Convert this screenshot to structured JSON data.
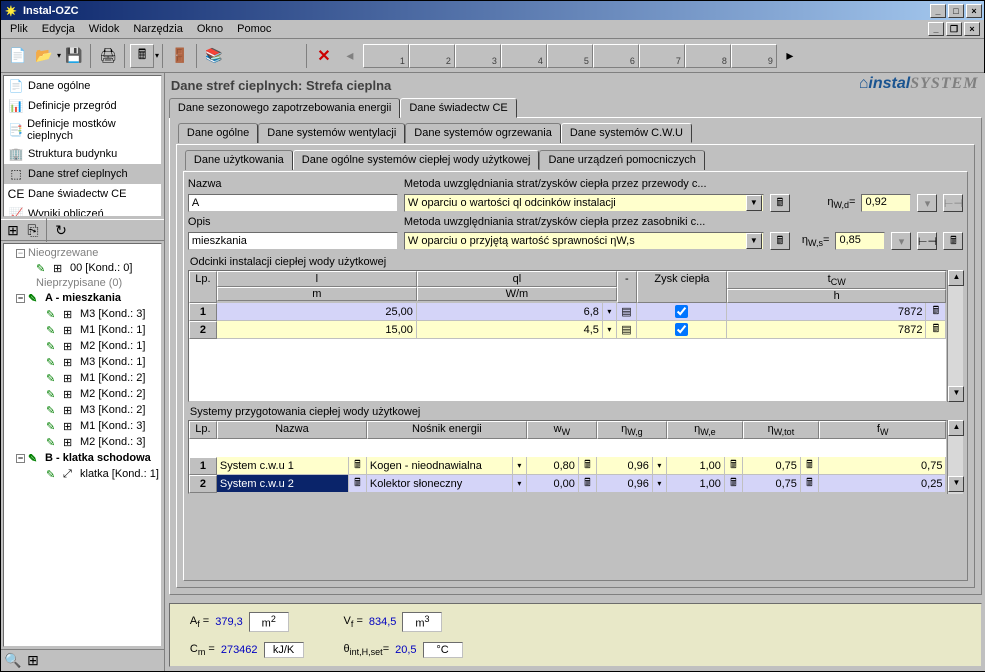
{
  "window_title": "Instal-OZC",
  "menu": [
    "Plik",
    "Edycja",
    "Widok",
    "Narzędzia",
    "Okno",
    "Pomoc"
  ],
  "nav": [
    {
      "label": "Dane ogólne",
      "icon": "📄"
    },
    {
      "label": "Definicje przegród",
      "icon": "📊"
    },
    {
      "label": "Definicje mostków cieplnych",
      "icon": "📑"
    },
    {
      "label": "Struktura budynku",
      "icon": "🏢"
    },
    {
      "label": "Dane stref cieplnych",
      "icon": "⬚",
      "selected": true
    },
    {
      "label": "Dane świadectw CE",
      "icon": "CE"
    },
    {
      "label": "Wyniki obliczeń",
      "icon": "📈"
    }
  ],
  "tree": [
    {
      "label": "Nieogrzewane",
      "gray": true,
      "indent": 10,
      "expander": "-"
    },
    {
      "label": "00 [Kond.: 0]",
      "indent": 30,
      "icon": "✎",
      "icon2": "⊞"
    },
    {
      "label": "Nieprzypisane (0)",
      "gray": true,
      "indent": 30
    },
    {
      "label": "A - mieszkania",
      "indent": 10,
      "expander": "-",
      "bold": true,
      "icon": "✎"
    },
    {
      "label": "M3 [Kond.: 3]",
      "indent": 40,
      "icon": "✎",
      "icon2": "⊞"
    },
    {
      "label": "M1 [Kond.: 1]",
      "indent": 40,
      "icon": "✎",
      "icon2": "⊞"
    },
    {
      "label": "M2 [Kond.: 1]",
      "indent": 40,
      "icon": "✎",
      "icon2": "⊞"
    },
    {
      "label": "M3 [Kond.: 1]",
      "indent": 40,
      "icon": "✎",
      "icon2": "⊞"
    },
    {
      "label": "M1 [Kond.: 2]",
      "indent": 40,
      "icon": "✎",
      "icon2": "⊞"
    },
    {
      "label": "M2 [Kond.: 2]",
      "indent": 40,
      "icon": "✎",
      "icon2": "⊞"
    },
    {
      "label": "M3 [Kond.: 2]",
      "indent": 40,
      "icon": "✎",
      "icon2": "⊞"
    },
    {
      "label": "M1 [Kond.: 3]",
      "indent": 40,
      "icon": "✎",
      "icon2": "⊞"
    },
    {
      "label": "M2 [Kond.: 3]",
      "indent": 40,
      "icon": "✎",
      "icon2": "⊞"
    },
    {
      "label": "B - klatka schodowa",
      "indent": 10,
      "expander": "-",
      "icon": "✎",
      "bold": true
    },
    {
      "label": "klatka [Kond.: 1]",
      "indent": 40,
      "icon": "✎",
      "icon2": "⤢"
    }
  ],
  "content_title": "Dane stref cieplnych: Strefa cieplna",
  "brand1": "instal",
  "brand2": "SYSTEM",
  "tabs1": [
    {
      "label": "Dane sezonowego zapotrzebowania energii"
    },
    {
      "label": "Dane świadectw CE",
      "active": true
    }
  ],
  "tabs2": [
    {
      "label": "Dane ogólne"
    },
    {
      "label": "Dane systemów wentylacji"
    },
    {
      "label": "Dane systemów ogrzewania"
    },
    {
      "label": "Dane systemów C.W.U",
      "active": true
    }
  ],
  "tabs3": [
    {
      "label": "Dane użytkowania"
    },
    {
      "label": "Dane ogólne systemów ciepłej wody użytkowej",
      "active": true
    },
    {
      "label": "Dane urządzeń pomocniczych"
    }
  ],
  "form": {
    "name_label": "Nazwa",
    "name_value": "A",
    "opis_label": "Opis",
    "opis_value": "mieszkania",
    "metoda1_label": "Metoda uwzględniania strat/zysków ciepła przez przewody c...",
    "metoda1_value": "W oparciu o wartości ql odcinków instalacji",
    "metoda2_label": "Metoda uwzględniania strat/zysków ciepła przez zasobniki c...",
    "metoda2_value": "W oparciu o przyjętą wartość sprawności ηW,s",
    "eta_wd_label": "ηW,d=",
    "eta_wd_value": "0,92",
    "eta_ws_label": "ηW,s=",
    "eta_ws_value": "0,85"
  },
  "grid1": {
    "title": "Odcinki instalacji ciepłej wody użytkowej",
    "headers": {
      "lp": "Lp.",
      "l": "l",
      "l_sub": "m",
      "ql": "ql",
      "ql_sub": "W/m",
      "dash": "-",
      "zysk": "Zysk ciepła",
      "tcw": "tCW",
      "tcw_sub": "h"
    },
    "rows": [
      {
        "n": "1",
        "l": "25,00",
        "ql": "6,8",
        "zysk": true,
        "tcw": "7872"
      },
      {
        "n": "2",
        "l": "15,00",
        "ql": "4,5",
        "zysk": true,
        "tcw": "7872"
      }
    ]
  },
  "grid2": {
    "title": "Systemy przygotowania ciepłej wody użytkowej",
    "headers": {
      "lp": "Lp.",
      "nazwa": "Nazwa",
      "nosnik": "Nośnik energii",
      "ww": "wW",
      "nwg": "ηW,g",
      "nwe": "ηW,e",
      "nwtot": "ηW,tot",
      "fw": "fW"
    },
    "rows": [
      {
        "n": "1",
        "nazwa": "System c.w.u 1",
        "nosnik": "Kogen - nieodnawialna",
        "ww": "0,80",
        "nwg": "0,96",
        "nwe": "1,00",
        "nwtot": "0,75",
        "fw": "0,75"
      },
      {
        "n": "2",
        "nazwa": "System c.w.u 2",
        "nosnik": "Kolektor słoneczny",
        "ww": "0,00",
        "nwg": "0,96",
        "nwe": "1,00",
        "nwtot": "0,75",
        "fw": "0,25"
      }
    ]
  },
  "status": {
    "af_label": "Af =",
    "af_val": "379,3",
    "af_unit": "m²",
    "vf_label": "Vf =",
    "vf_val": "834,5",
    "vf_unit": "m³",
    "cm_label": "Cm =",
    "cm_val": "273462",
    "cm_unit": "kJ/K",
    "theta_label": "θint,H,set=",
    "theta_val": "20,5",
    "theta_unit": "°C"
  },
  "toolbar_nums": [
    "1",
    "2",
    "3",
    "4",
    "5",
    "6",
    "7",
    "8",
    "9"
  ]
}
